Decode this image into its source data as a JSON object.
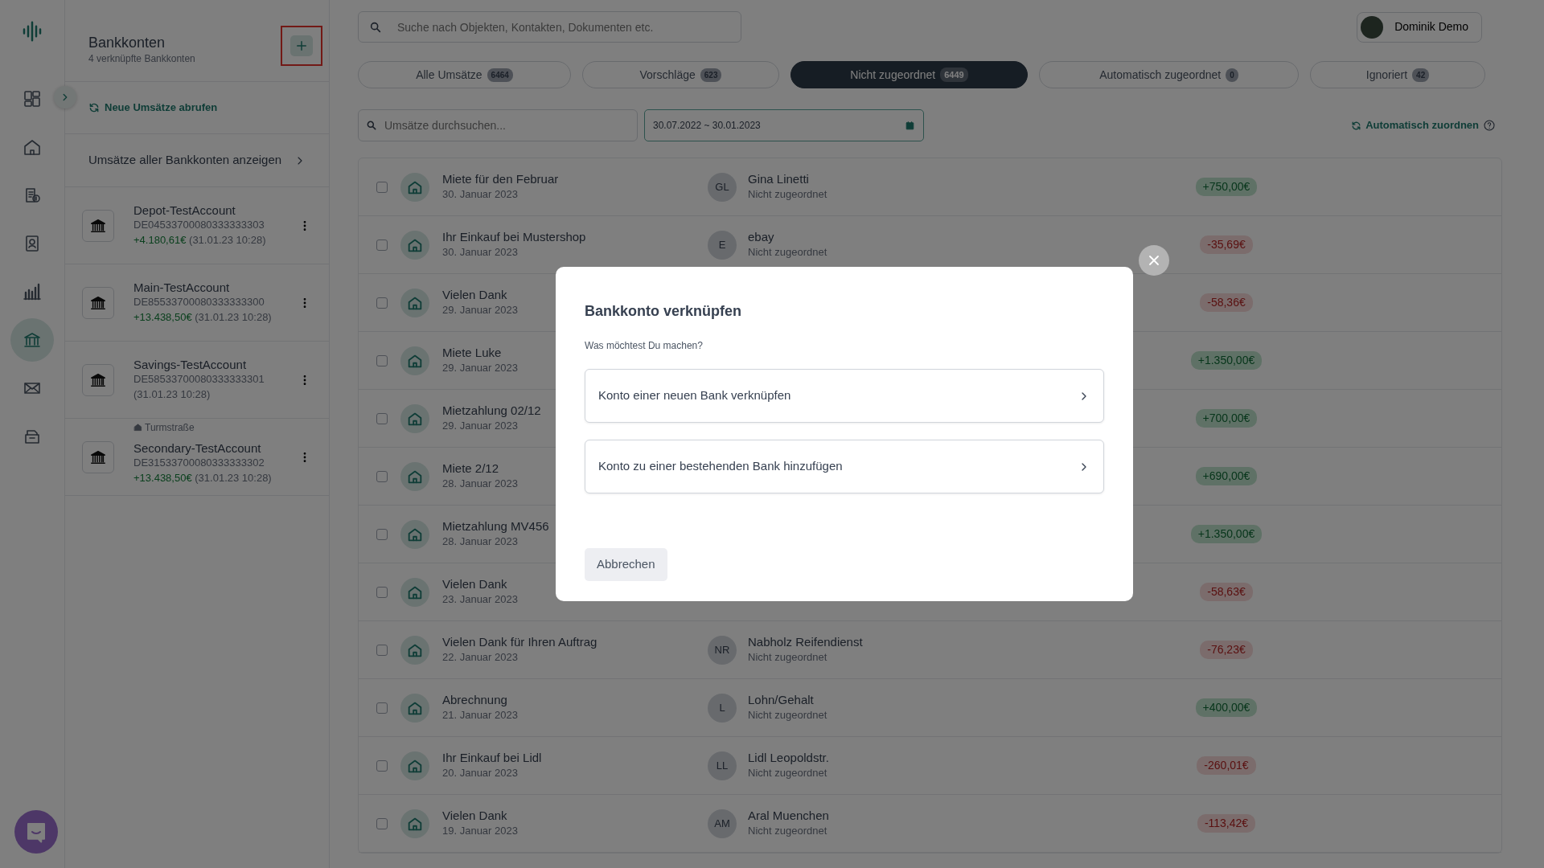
{
  "rail": {
    "items": [
      {
        "kind": "dashboard",
        "selected": false
      },
      {
        "kind": "home",
        "selected": false
      },
      {
        "kind": "invoice",
        "selected": false
      },
      {
        "kind": "contacts",
        "selected": false
      },
      {
        "kind": "chart",
        "selected": false
      },
      {
        "kind": "bank",
        "selected": true
      },
      {
        "kind": "mail",
        "selected": false
      },
      {
        "kind": "archive",
        "selected": false
      }
    ]
  },
  "accounts_panel": {
    "title": "Bankkonten",
    "subtitle": "4 verknüpfte Bankkonten",
    "add_button": {
      "highlighted": true
    },
    "refresh_link": "Neue Umsätze abrufen",
    "all_link": "Umsätze aller Bankkonten anzeigen",
    "accounts": [
      {
        "name": "Depot-TestAccount",
        "iban": "DE04533700080333333303",
        "balance": "+4.180,61€",
        "timestamp": "(31.01.23 10:28)"
      },
      {
        "name": "Main-TestAccount",
        "iban": "DE85533700080333333300",
        "balance": "+13.438,50€",
        "timestamp": "(31.01.23 10:28)"
      },
      {
        "name": "Savings-TestAccount",
        "iban": "DE58533700080333333301",
        "timestamp": "(31.01.23 10:28)"
      },
      {
        "name": "Secondary-TestAccount",
        "iban": "DE31533700080333333302",
        "balance": "+13.438,50€",
        "timestamp": "(31.01.23 10:28)",
        "tag": "Turmstraße"
      }
    ]
  },
  "search": {
    "placeholder": "Suche nach Objekten, Kontakten, Dokumenten etc."
  },
  "user": {
    "name": "Dominik Demo"
  },
  "tabs": [
    {
      "label": "Alle Umsätze",
      "count": "6464",
      "selected": false
    },
    {
      "label": "Vorschläge",
      "count": "623",
      "selected": false
    },
    {
      "label": "Nicht zugeordnet",
      "count": "6449",
      "selected": true
    },
    {
      "label": "Automatisch zugeordnet",
      "count": "0",
      "selected": false
    },
    {
      "label": "Ignoriert",
      "count": "42",
      "selected": false
    }
  ],
  "filter": {
    "placeholder": "Umsätze durchsuchen...",
    "date_range": "30.07.2022 ~ 30.01.2023"
  },
  "auto_assign_link": "Automatisch zuordnen",
  "transactions": [
    {
      "title": "Miete für den Februar",
      "date": "30. Januar 2023",
      "initials": "GL",
      "contact": "Gina Linetti",
      "status": "Nicht zugeordnet",
      "amount": "+750,00€",
      "kind": "credit",
      "checked": false
    },
    {
      "title": "Ihr Einkauf bei Mustershop",
      "date": "30. Januar 2023",
      "initials": "E",
      "contact": "ebay",
      "status": "Nicht zugeordnet",
      "amount": "-35,69€",
      "kind": "debit",
      "checked": false
    },
    {
      "title": "Vielen Dank",
      "date": "29. Januar 2023",
      "amount": "-58,36€",
      "kind": "debit",
      "checked": false
    },
    {
      "title": "Miete Luke",
      "date": "29. Januar 2023",
      "amount": "+1.350,00€",
      "kind": "credit",
      "checked": false
    },
    {
      "title": "Mietzahlung 02/12",
      "date": "29. Januar 2023",
      "amount": "+700,00€",
      "kind": "credit",
      "checked": false
    },
    {
      "title": "Miete 2/12",
      "date": "28. Januar 2023",
      "amount": "+690,00€",
      "kind": "credit",
      "checked": false
    },
    {
      "title": "Mietzahlung MV456",
      "date": "28. Januar 2023",
      "amount": "+1.350,00€",
      "kind": "credit",
      "checked": false
    },
    {
      "title": "Vielen Dank",
      "date": "23. Januar 2023",
      "amount": "-58,63€",
      "kind": "debit",
      "checked": false
    },
    {
      "title": "Vielen Dank für Ihren Auftrag",
      "date": "22. Januar 2023",
      "initials": "NR",
      "contact": "Nabholz Reifendienst",
      "status": "Nicht zugeordnet",
      "amount": "-76,23€",
      "kind": "debit",
      "checked": false
    },
    {
      "title": "Abrechnung",
      "date": "21. Januar 2023",
      "initials": "L",
      "contact": "Lohn/Gehalt",
      "status": "Nicht zugeordnet",
      "amount": "+400,00€",
      "kind": "credit",
      "checked": false
    },
    {
      "title": "Ihr Einkauf bei Lidl",
      "date": "20. Januar 2023",
      "initials": "LL",
      "contact": "Lidl Leopoldstr.",
      "status": "Nicht zugeordnet",
      "amount": "-260,01€",
      "kind": "debit",
      "checked": false
    },
    {
      "title": "Vielen Dank",
      "date": "19. Januar 2023",
      "initials": "AM",
      "contact": "Aral Muenchen",
      "status": "Nicht zugeordnet",
      "amount": "-113,42€",
      "kind": "debit",
      "checked": false
    }
  ],
  "modal": {
    "title": "Bankkonto verknüpfen",
    "prompt": "Was möchtest Du machen?",
    "options": [
      "Konto einer neuen Bank verknüpfen",
      "Konto zu einer bestehenden Bank hinzufügen"
    ],
    "cancel": "Abbrechen"
  }
}
